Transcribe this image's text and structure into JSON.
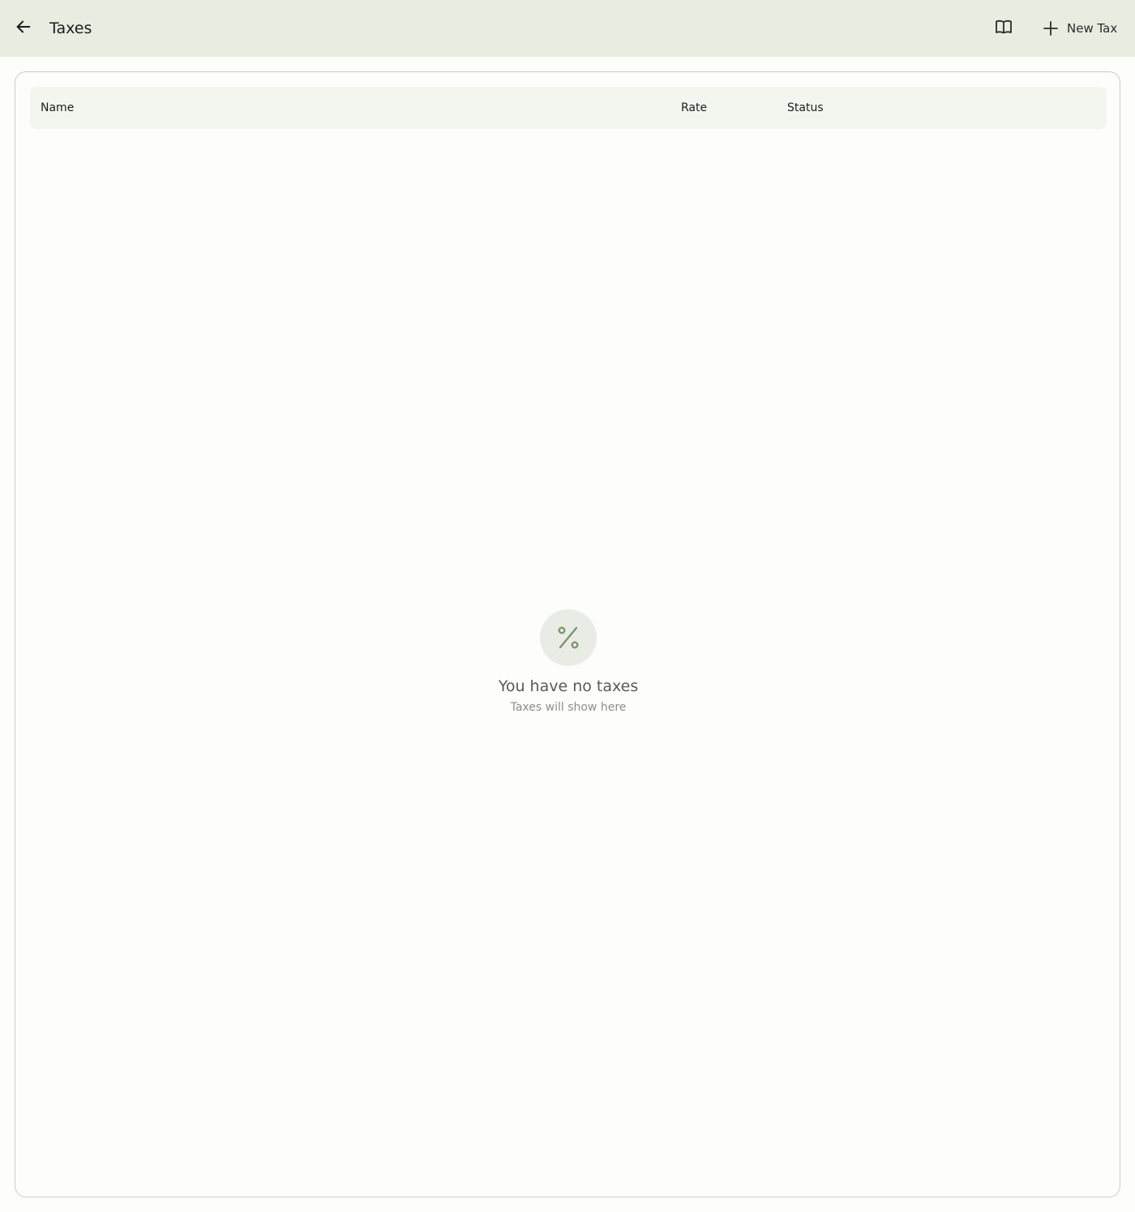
{
  "header": {
    "title": "Taxes",
    "back_icon": "arrow-left-icon",
    "docs_icon": "book-open-icon",
    "new_button_label": "New Tax",
    "new_button_icon": "plus-icon"
  },
  "table": {
    "columns": [
      "Name",
      "Rate",
      "Status"
    ],
    "rows": []
  },
  "empty_state": {
    "icon": "percent-icon",
    "title": "You have no taxes",
    "subtitle": "Taxes will show here"
  },
  "colors": {
    "topbar_bg": "#e7ede0",
    "page_bg": "#fdfdf9",
    "header_row_bg": "#f3f6ee",
    "accent_icon": "#7f946d"
  }
}
